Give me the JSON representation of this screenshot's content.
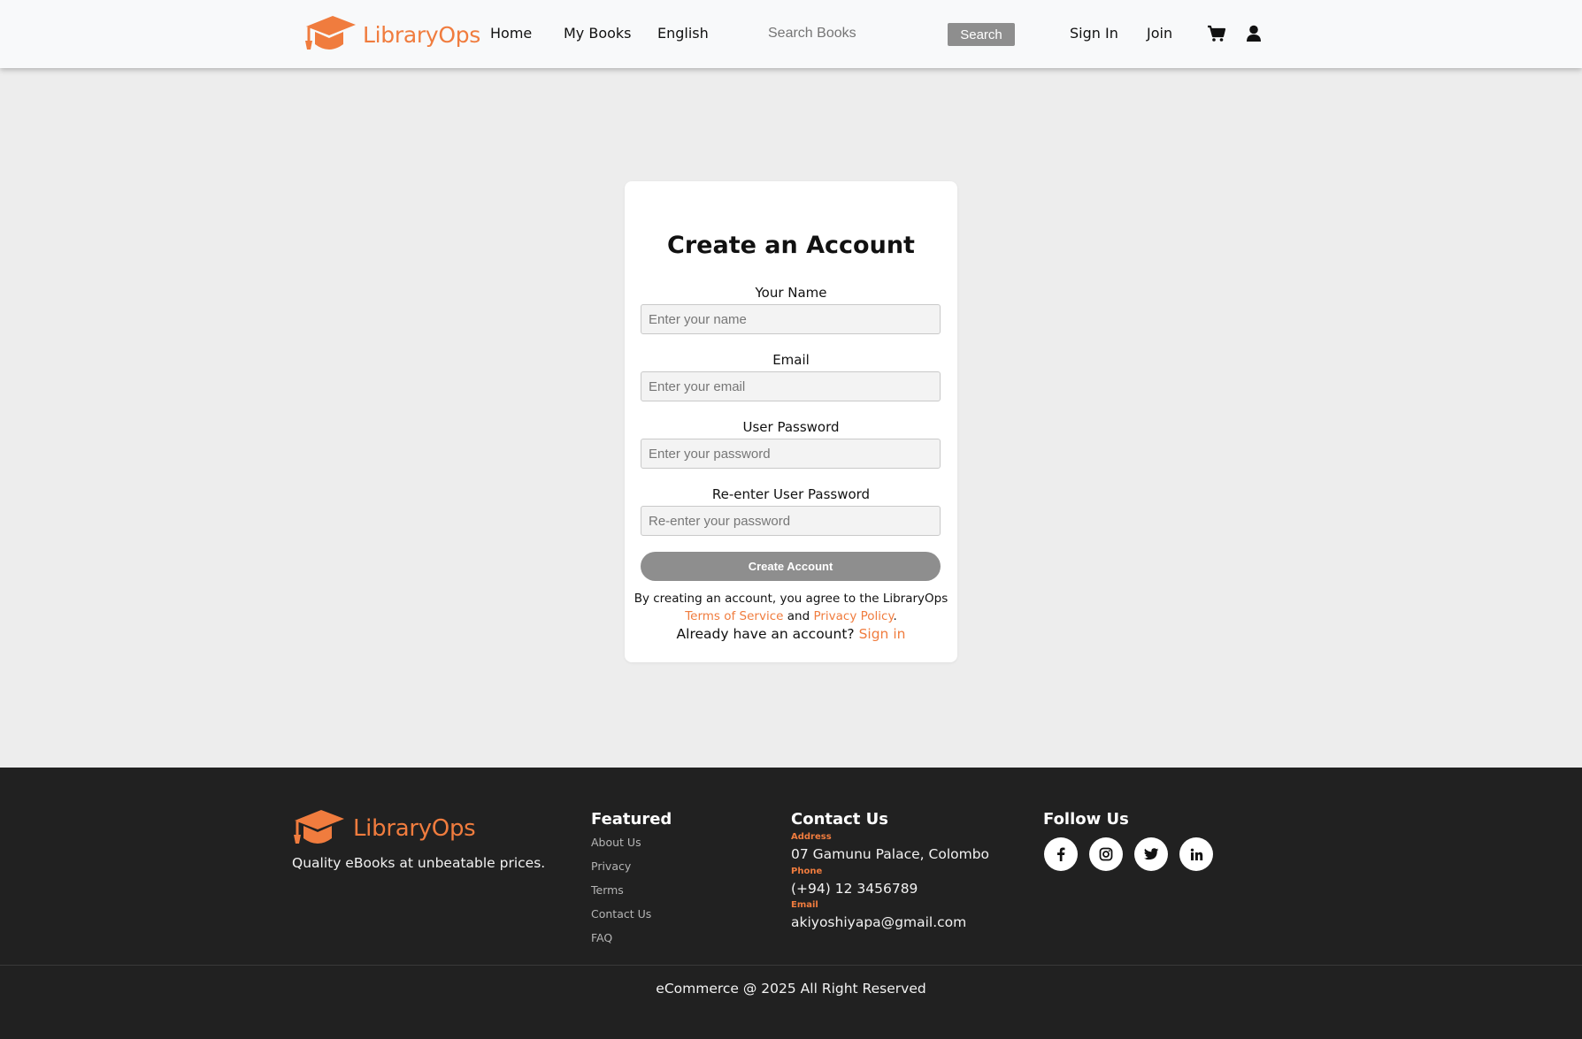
{
  "header": {
    "logo_text": "LibraryOps",
    "nav": {
      "home": "Home",
      "my_books": "My Books",
      "language": "English"
    },
    "search": {
      "placeholder": "Search Books",
      "button": "Search"
    },
    "auth": {
      "sign_in": "Sign In",
      "join": "Join"
    },
    "icons": {
      "cart": "cart-icon",
      "user": "user-icon"
    }
  },
  "form": {
    "title": "Create an Account",
    "fields": [
      {
        "label": "Your Name",
        "placeholder": "Enter your name"
      },
      {
        "label": "Email",
        "placeholder": "Enter your email"
      },
      {
        "label": "User Password",
        "placeholder": "Enter your password"
      },
      {
        "label": "Re-enter User Password",
        "placeholder": "Re-enter your password"
      }
    ],
    "submit": "Create Account",
    "terms_prefix": "By creating an account, you agree to the LibraryOps",
    "terms_link": "Terms of Service",
    "terms_and": "and",
    "privacy_link": "Privacy Policy",
    "terms_suffix": ".",
    "signin_prompt": "Already have an account?",
    "signin_link": "Sign in"
  },
  "footer": {
    "logo_text": "LibraryOps",
    "tagline": "Quality eBooks at unbeatable prices.",
    "featured": {
      "title": "Featured",
      "links": [
        "About Us",
        "Privacy",
        "Terms",
        "Contact Us",
        "FAQ"
      ]
    },
    "contact": {
      "title": "Contact Us",
      "address_label": "Address",
      "address": "07 Gamunu Palace, Colombo",
      "phone_label": "Phone",
      "phone": "(+94) 12 3456789",
      "email_label": "Email",
      "email": "akiyoshiyapa@gmail.com"
    },
    "follow": {
      "title": "Follow Us",
      "icons": [
        "facebook-icon",
        "instagram-icon",
        "twitter-icon",
        "linkedin-icon"
      ]
    },
    "copyright": "eCommerce @ 2025 All Right Reserved"
  },
  "colors": {
    "accent": "#f07c3e",
    "footer_bg": "#212121",
    "page_bg": "#ededed",
    "button_gray": "#8e8e8e"
  }
}
